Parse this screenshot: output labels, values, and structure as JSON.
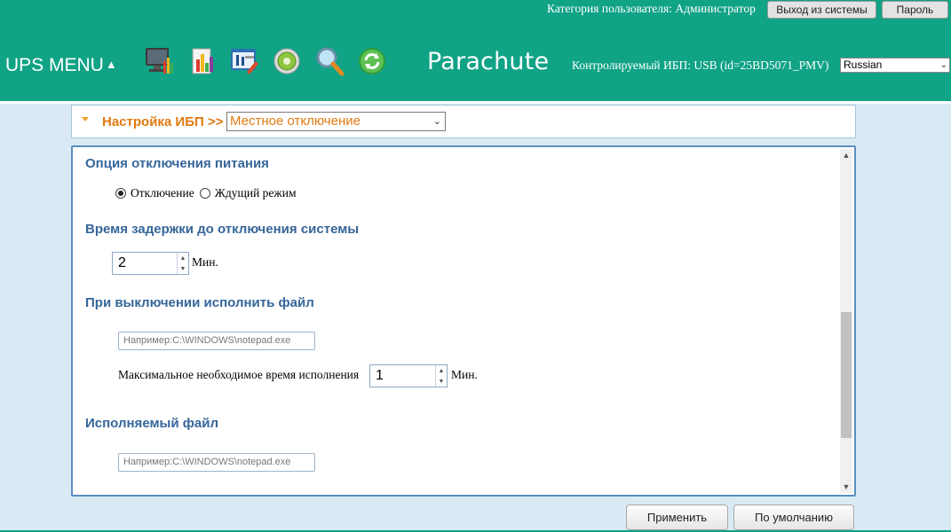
{
  "header": {
    "user_category": "Категория пользователя: Администратор",
    "logout_label": "Выход из системы",
    "password_label": "Пароль",
    "ups_menu_label": "UPS MENU",
    "brand": "Parachute",
    "monitored_ups": "Контролируемый ИБП: USB (id=25BD5071_PMV)",
    "language": "Russian",
    "toolbar_icons": [
      "monitor-icon",
      "chart-icon",
      "settings-tools-icon",
      "gear-icon",
      "search-icon",
      "refresh-icon"
    ],
    "colors": {
      "header_bg": "#10a386",
      "accent_orange": "#e07a10",
      "section_blue": "#35669a"
    }
  },
  "settings_bar": {
    "label": "Настройка ИБП >>",
    "selected_page": "Местное отключение"
  },
  "panel": {
    "shutdown_option": {
      "title": "Опция отключения питания",
      "options": [
        {
          "label": "Отключение",
          "checked": true
        },
        {
          "label": "Ждущий режим",
          "checked": false
        }
      ]
    },
    "delay": {
      "title": "Время задержки до отключения системы",
      "value": "2",
      "unit": "Мин."
    },
    "on_shutdown_file": {
      "title": "При выключении исполнить файл",
      "placeholder": "Например:C:\\WINDOWS\\notepad.exe",
      "max_time_label": "Максимальное необходимое время исполнения",
      "max_time_value": "1",
      "max_time_unit": "Мин."
    },
    "executable_file": {
      "title": "Исполняемый файл",
      "placeholder": "Например:C:\\WINDOWS\\notepad.exe"
    }
  },
  "buttons": {
    "apply": "Применить",
    "default": "По умолчанию"
  }
}
